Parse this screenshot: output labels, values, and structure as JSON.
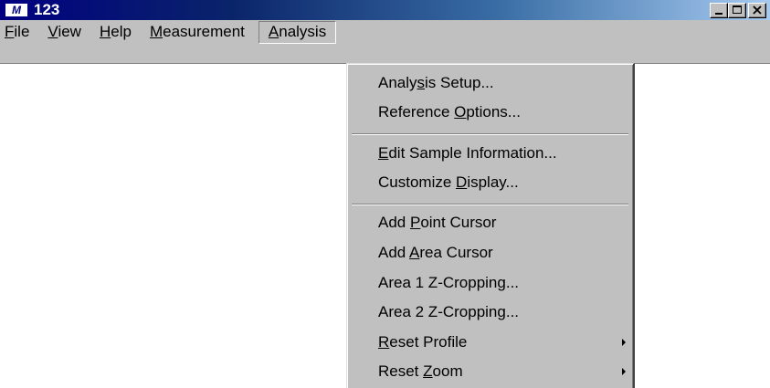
{
  "window": {
    "app_icon_text": "M",
    "title": "123"
  },
  "menubar": {
    "items": [
      {
        "mnemonic": "F",
        "rest": "ile"
      },
      {
        "mnemonic": "V",
        "rest": "iew"
      },
      {
        "mnemonic": "H",
        "rest": "elp"
      },
      {
        "mnemonic": "M",
        "rest": "easurement"
      },
      {
        "mnemonic": "A",
        "rest": "nalysis"
      }
    ]
  },
  "analysis_menu": {
    "items": [
      {
        "pre": "Analy",
        "mnemonic": "s",
        "post": "is Setup..."
      },
      {
        "pre": "Reference ",
        "mnemonic": "O",
        "post": "ptions..."
      },
      {
        "pre": "",
        "mnemonic": "E",
        "post": "dit Sample Information..."
      },
      {
        "pre": "Customize ",
        "mnemonic": "D",
        "post": "isplay..."
      },
      {
        "pre": "Add ",
        "mnemonic": "P",
        "post": "oint Cursor"
      },
      {
        "pre": "Add ",
        "mnemonic": "A",
        "post": "rea Cursor"
      },
      {
        "pre": "Area 1 Z-Cropping...",
        "mnemonic": "",
        "post": ""
      },
      {
        "pre": "Area 2 Z-Cropping...",
        "mnemonic": "",
        "post": ""
      },
      {
        "pre": "",
        "mnemonic": "R",
        "post": "eset Profile"
      },
      {
        "pre": "Reset ",
        "mnemonic": "Z",
        "post": "oom"
      }
    ]
  },
  "icons": {
    "minimize": "minimize-icon",
    "maximize": "maximize-icon",
    "close": "close-icon",
    "submenu": "submenu-arrow-icon"
  },
  "colors": {
    "titlebar_start": "#000080",
    "titlebar_end": "#a6caf0",
    "face": "#c0c0c0"
  }
}
